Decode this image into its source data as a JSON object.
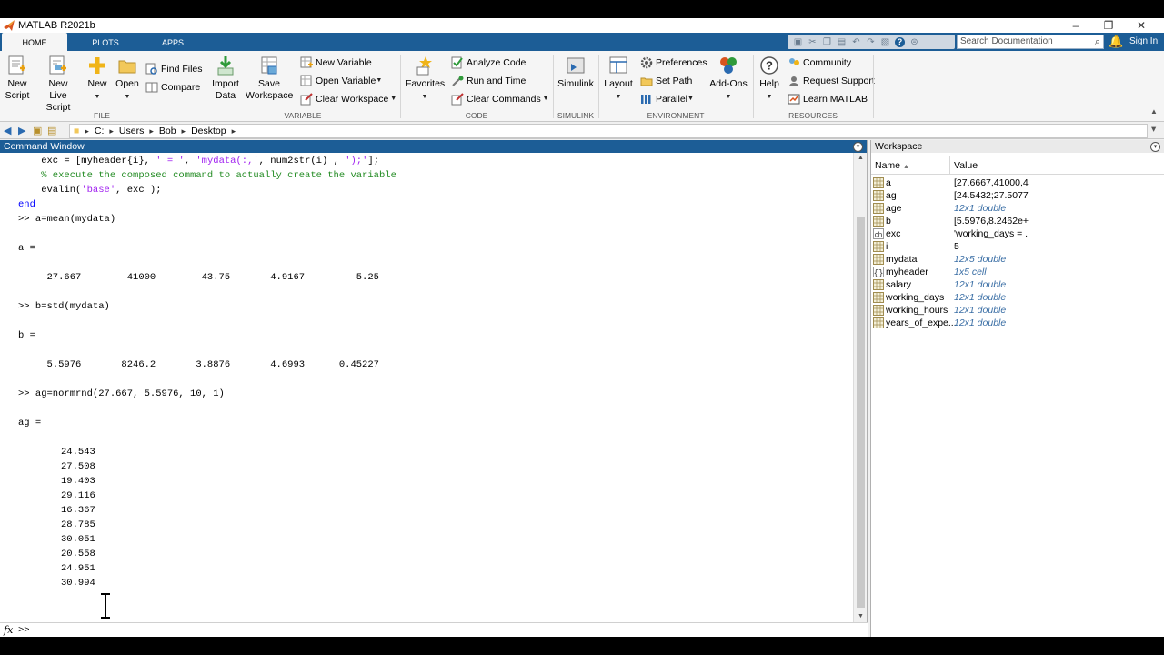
{
  "window": {
    "title": "MATLAB R2021b"
  },
  "tabs": [
    {
      "label": "HOME",
      "active": true
    },
    {
      "label": "PLOTS",
      "active": false
    },
    {
      "label": "APPS",
      "active": false
    }
  ],
  "search": {
    "placeholder": "Search Documentation"
  },
  "signin_label": "Sign In",
  "ribbon": {
    "file": {
      "group_label": "FILE",
      "new_script": [
        "New",
        "Script"
      ],
      "new_live_script": [
        "New",
        "Live Script"
      ],
      "new": "New",
      "open": "Open",
      "find_files": "Find Files",
      "compare": "Compare"
    },
    "variable": {
      "group_label": "VARIABLE",
      "import_data": [
        "Import",
        "Data"
      ],
      "save_workspace": [
        "Save",
        "Workspace"
      ],
      "new_variable": "New Variable",
      "open_variable": "Open Variable",
      "clear_workspace": "Clear Workspace"
    },
    "code": {
      "group_label": "CODE",
      "favorites": "Favorites",
      "analyze_code": "Analyze Code",
      "run_and_time": "Run and Time",
      "clear_commands": "Clear Commands"
    },
    "simulink": {
      "group_label": "SIMULINK",
      "simulink": "Simulink"
    },
    "environment": {
      "group_label": "ENVIRONMENT",
      "layout": "Layout",
      "preferences": "Preferences",
      "set_path": "Set Path",
      "parallel": "Parallel",
      "add_ons": "Add-Ons"
    },
    "resources": {
      "group_label": "RESOURCES",
      "help": "Help",
      "community": "Community",
      "request_support": "Request Support",
      "learn_matlab": "Learn MATLAB"
    }
  },
  "path": [
    "C:",
    "Users",
    "Bob",
    "Desktop"
  ],
  "command_window": {
    "title": "Command Window",
    "lines": {
      "l1a": "    exc = [myheader{i}, ",
      "l1b": "' = '",
      "l1c": ", ",
      "l1d": "'mydata(:,'",
      "l1e": ", num2str(i) , ",
      "l1f": "');'",
      "l1g": "];",
      "l2": "    % execute the composed command to actually create the variable",
      "l3a": "    evalin(",
      "l3b": "'base'",
      "l3c": ", exc );",
      "l4": "end",
      "l5": ">> a=mean(mydata)",
      "l6": "a =",
      "l7": "     27.667        41000        43.75       4.9167         5.25",
      "l8": ">> b=std(mydata)",
      "l9": "b =",
      "l10": "     5.5976       8246.2       3.8876       4.6993      0.45227",
      "l11": ">> ag=normrnd(27.667, 5.5976, 10, 1)",
      "l12": "ag =",
      "ag_values": [
        "24.543",
        "27.508",
        "19.403",
        "29.116",
        "16.367",
        "28.785",
        "30.051",
        "20.558",
        "24.951",
        "30.994"
      ]
    },
    "fx_label": "fx",
    "prompt": ">>"
  },
  "workspace": {
    "title": "Workspace",
    "col_name": "Name",
    "col_value": "Value",
    "rows": [
      {
        "name": "a",
        "value": "[27.6667,41000,4...",
        "info": false,
        "icon": "matrix-icon"
      },
      {
        "name": "ag",
        "value": "[24.5432;27.5077;...",
        "info": false,
        "icon": "matrix-icon"
      },
      {
        "name": "age",
        "value": "12x1 double",
        "info": true,
        "icon": "matrix-icon"
      },
      {
        "name": "b",
        "value": "[5.5976,8.2462e+...",
        "info": false,
        "icon": "matrix-icon"
      },
      {
        "name": "exc",
        "value": "'working_days = ...",
        "info": false,
        "icon": "char-icon"
      },
      {
        "name": "i",
        "value": "5",
        "info": false,
        "icon": "matrix-icon"
      },
      {
        "name": "mydata",
        "value": "12x5 double",
        "info": true,
        "icon": "matrix-icon"
      },
      {
        "name": "myheader",
        "value": "1x5 cell",
        "info": true,
        "icon": "cell-icon"
      },
      {
        "name": "salary",
        "value": "12x1 double",
        "info": true,
        "icon": "matrix-icon"
      },
      {
        "name": "working_days",
        "value": "12x1 double",
        "info": true,
        "icon": "matrix-icon"
      },
      {
        "name": "working_hours",
        "value": "12x1 double",
        "info": true,
        "icon": "matrix-icon"
      },
      {
        "name": "years_of_expe...",
        "value": "12x1 double",
        "info": true,
        "icon": "matrix-icon"
      }
    ]
  },
  "colors": {
    "accent": "#1c5d96",
    "comment": "#228b22",
    "string": "#a020f0",
    "keyword": "#0000ff"
  }
}
